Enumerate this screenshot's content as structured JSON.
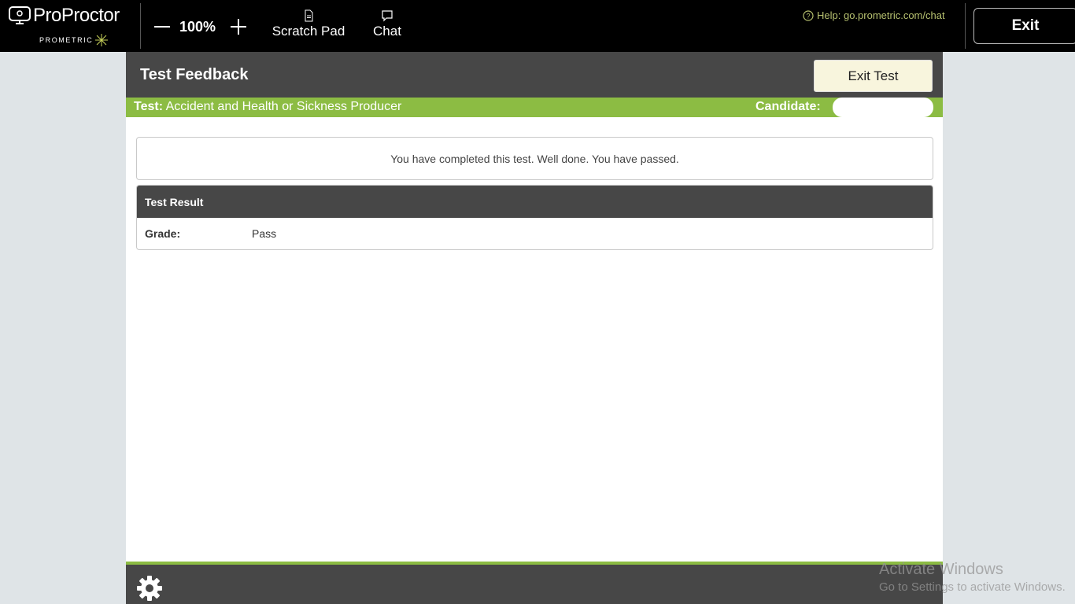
{
  "brand": {
    "name": "ProProctor",
    "trademark": "™",
    "sub": "PROMETRIC"
  },
  "toolbar": {
    "zoom_level": "100%",
    "scratch_pad_label": "Scratch Pad",
    "chat_label": "Chat",
    "help_text": "Help: go.prometric.com/chat",
    "exit_label": "Exit"
  },
  "page": {
    "title": "Test Feedback",
    "exit_test_label": "Exit Test",
    "test_label": "Test:",
    "test_name": "Accident and Health or Sickness Producer",
    "candidate_label": "Candidate:",
    "message": "You have completed this test. Well done. You have passed.",
    "result": {
      "heading": "Test Result",
      "grade_label": "Grade:",
      "grade_value": "Pass"
    }
  },
  "watermark": {
    "line1": "Activate Windows",
    "line2": "Go to Settings to activate Windows."
  },
  "colors": {
    "topbar": "#000000",
    "panel_header": "#474747",
    "accent_green": "#8cbc43",
    "exit_test_bg": "#f8f5dd",
    "help_text": "#b6c06f"
  }
}
